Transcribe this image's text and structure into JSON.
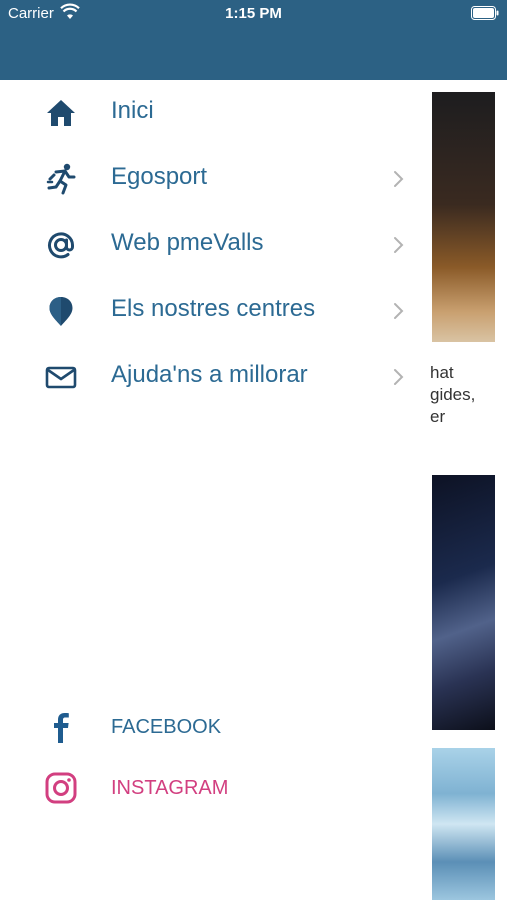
{
  "status_bar": {
    "carrier": "Carrier",
    "time": "1:15 PM"
  },
  "colors": {
    "header": "#2c6184",
    "menu_text": "#2c6a93",
    "icon": "#1f4a6e",
    "instagram": "#d23f80"
  },
  "menu": {
    "items": [
      {
        "label": "Inici",
        "icon": "home-icon",
        "has_chevron": false
      },
      {
        "label": "Egosport",
        "icon": "running-icon",
        "has_chevron": true
      },
      {
        "label": "Web pmeValls",
        "icon": "at-icon",
        "has_chevron": true
      },
      {
        "label": "Els nostres centres",
        "icon": "location-pin-icon",
        "has_chevron": true
      },
      {
        "label": "Ajuda'ns a millorar",
        "icon": "envelope-icon",
        "has_chevron": true
      }
    ]
  },
  "social": {
    "facebook_label": "FACEBOOK",
    "instagram_label": "INSTAGRAM"
  },
  "background": {
    "text_snippet": "hat\ngides,\ner"
  }
}
